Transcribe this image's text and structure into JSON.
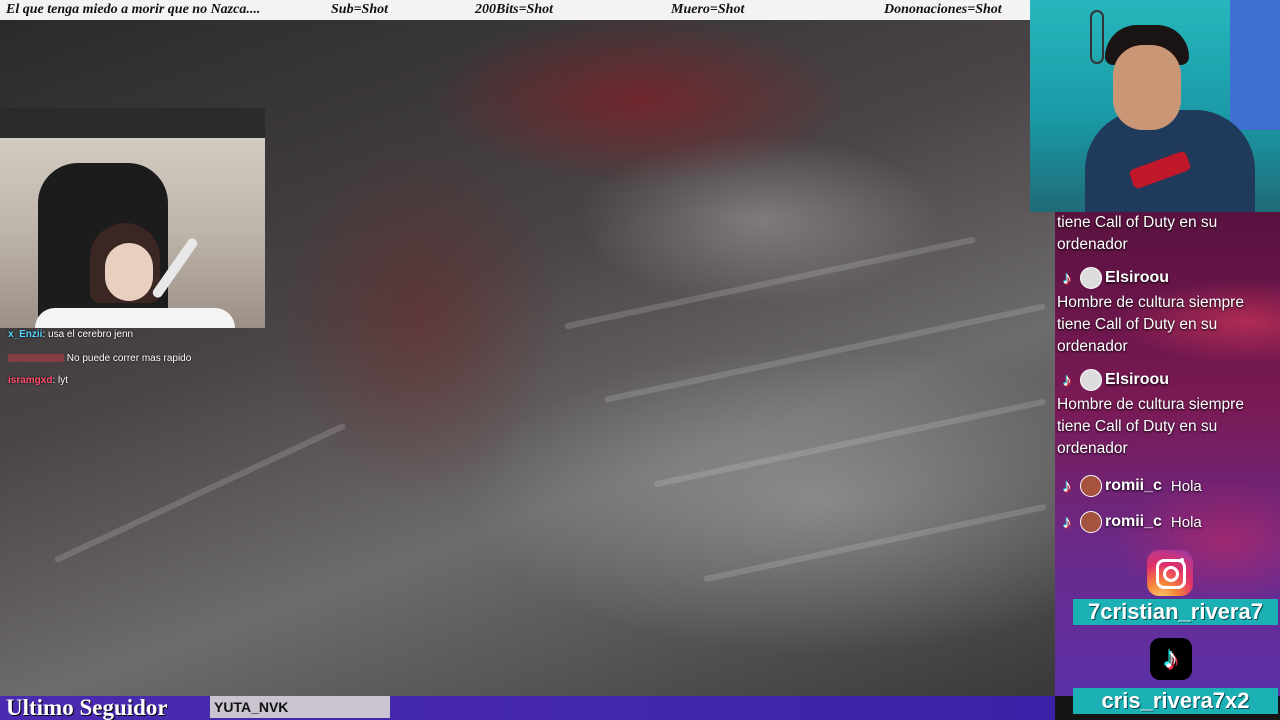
{
  "ticker": [
    "El que tenga miedo a morir que no Nazca....",
    "Sub=Shot",
    "200Bits=Shot",
    "Muero=Shot",
    "Dononaciones=Shot"
  ],
  "left_chat": [
    {
      "user": "x_Enzii",
      "message": "usa el cerebro jenn",
      "color": "#56d7ff"
    },
    {
      "user": "",
      "message": "No puede correr mas rapido",
      "color": "#ff3b3b"
    },
    {
      "user": "isramgxd",
      "message": "lyt",
      "color": "#ff4d6d"
    }
  ],
  "right_chat": {
    "partial": "tiene Call of Duty en su ordenador",
    "messages": [
      {
        "user": "Elsiroou",
        "text": "Hombre de cultura siempre tiene Call of Duty en su ordenador"
      },
      {
        "user": "Elsiroou",
        "text": "Hombre de cultura siempre tiene Call of Duty en su ordenador"
      },
      {
        "user": "romii_c",
        "text": "Hola"
      },
      {
        "user": "romii_c",
        "text": "Hola"
      }
    ]
  },
  "socials": {
    "instagram_icon": "instagram-icon",
    "instagram_handle": "7cristian_rivera7",
    "tiktok_icon": "tiktok-icon",
    "tiktok_handle": "cris_rivera7x2"
  },
  "bottom_bar": {
    "label": "Ultimo Seguidor",
    "name": "YUTA_NVK"
  },
  "colors": {
    "bottom_bar": "#3c22a8",
    "handle_bg": "#1ab0b4",
    "chat_bg": "#6a2a8a"
  }
}
